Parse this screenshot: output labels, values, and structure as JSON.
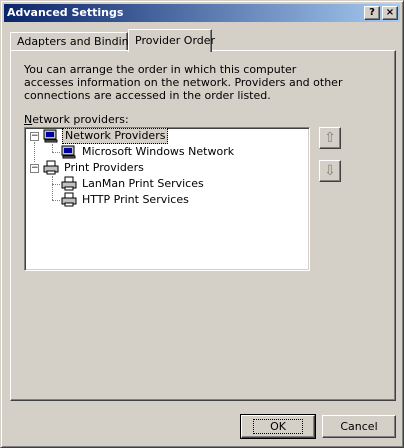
{
  "window": {
    "title": "Advanced Settings",
    "help_glyph": "?",
    "close_glyph": "×"
  },
  "tabs": [
    {
      "label": "Adapters and Bindings",
      "selected": false
    },
    {
      "label": "Provider Order",
      "selected": true
    }
  ],
  "panel": {
    "description": "You can arrange the order in which this computer accesses information on the network.  Providers and other connections are accessed in the order listed.",
    "list_label_accel": "N",
    "list_label_rest": "etwork providers:",
    "tree": [
      {
        "label": "Network Providers",
        "icon": "network-computer-icon",
        "expander": "−",
        "selected": true
      },
      {
        "label": "Microsoft Windows Network",
        "icon": "network-computer-icon"
      },
      {
        "label": "Print Providers",
        "icon": "printer-icon",
        "expander": "−"
      },
      {
        "label": "LanMan Print Services",
        "icon": "printer-icon"
      },
      {
        "label": "HTTP Print Services",
        "icon": "printer-icon"
      }
    ],
    "move_up_glyph": "⇧",
    "move_down_glyph": "⇩"
  },
  "buttons": {
    "ok": "OK",
    "cancel": "Cancel"
  },
  "colors": {
    "title_start": "#0a246a",
    "title_end": "#a6caf0",
    "face": "#d4d0c8"
  }
}
